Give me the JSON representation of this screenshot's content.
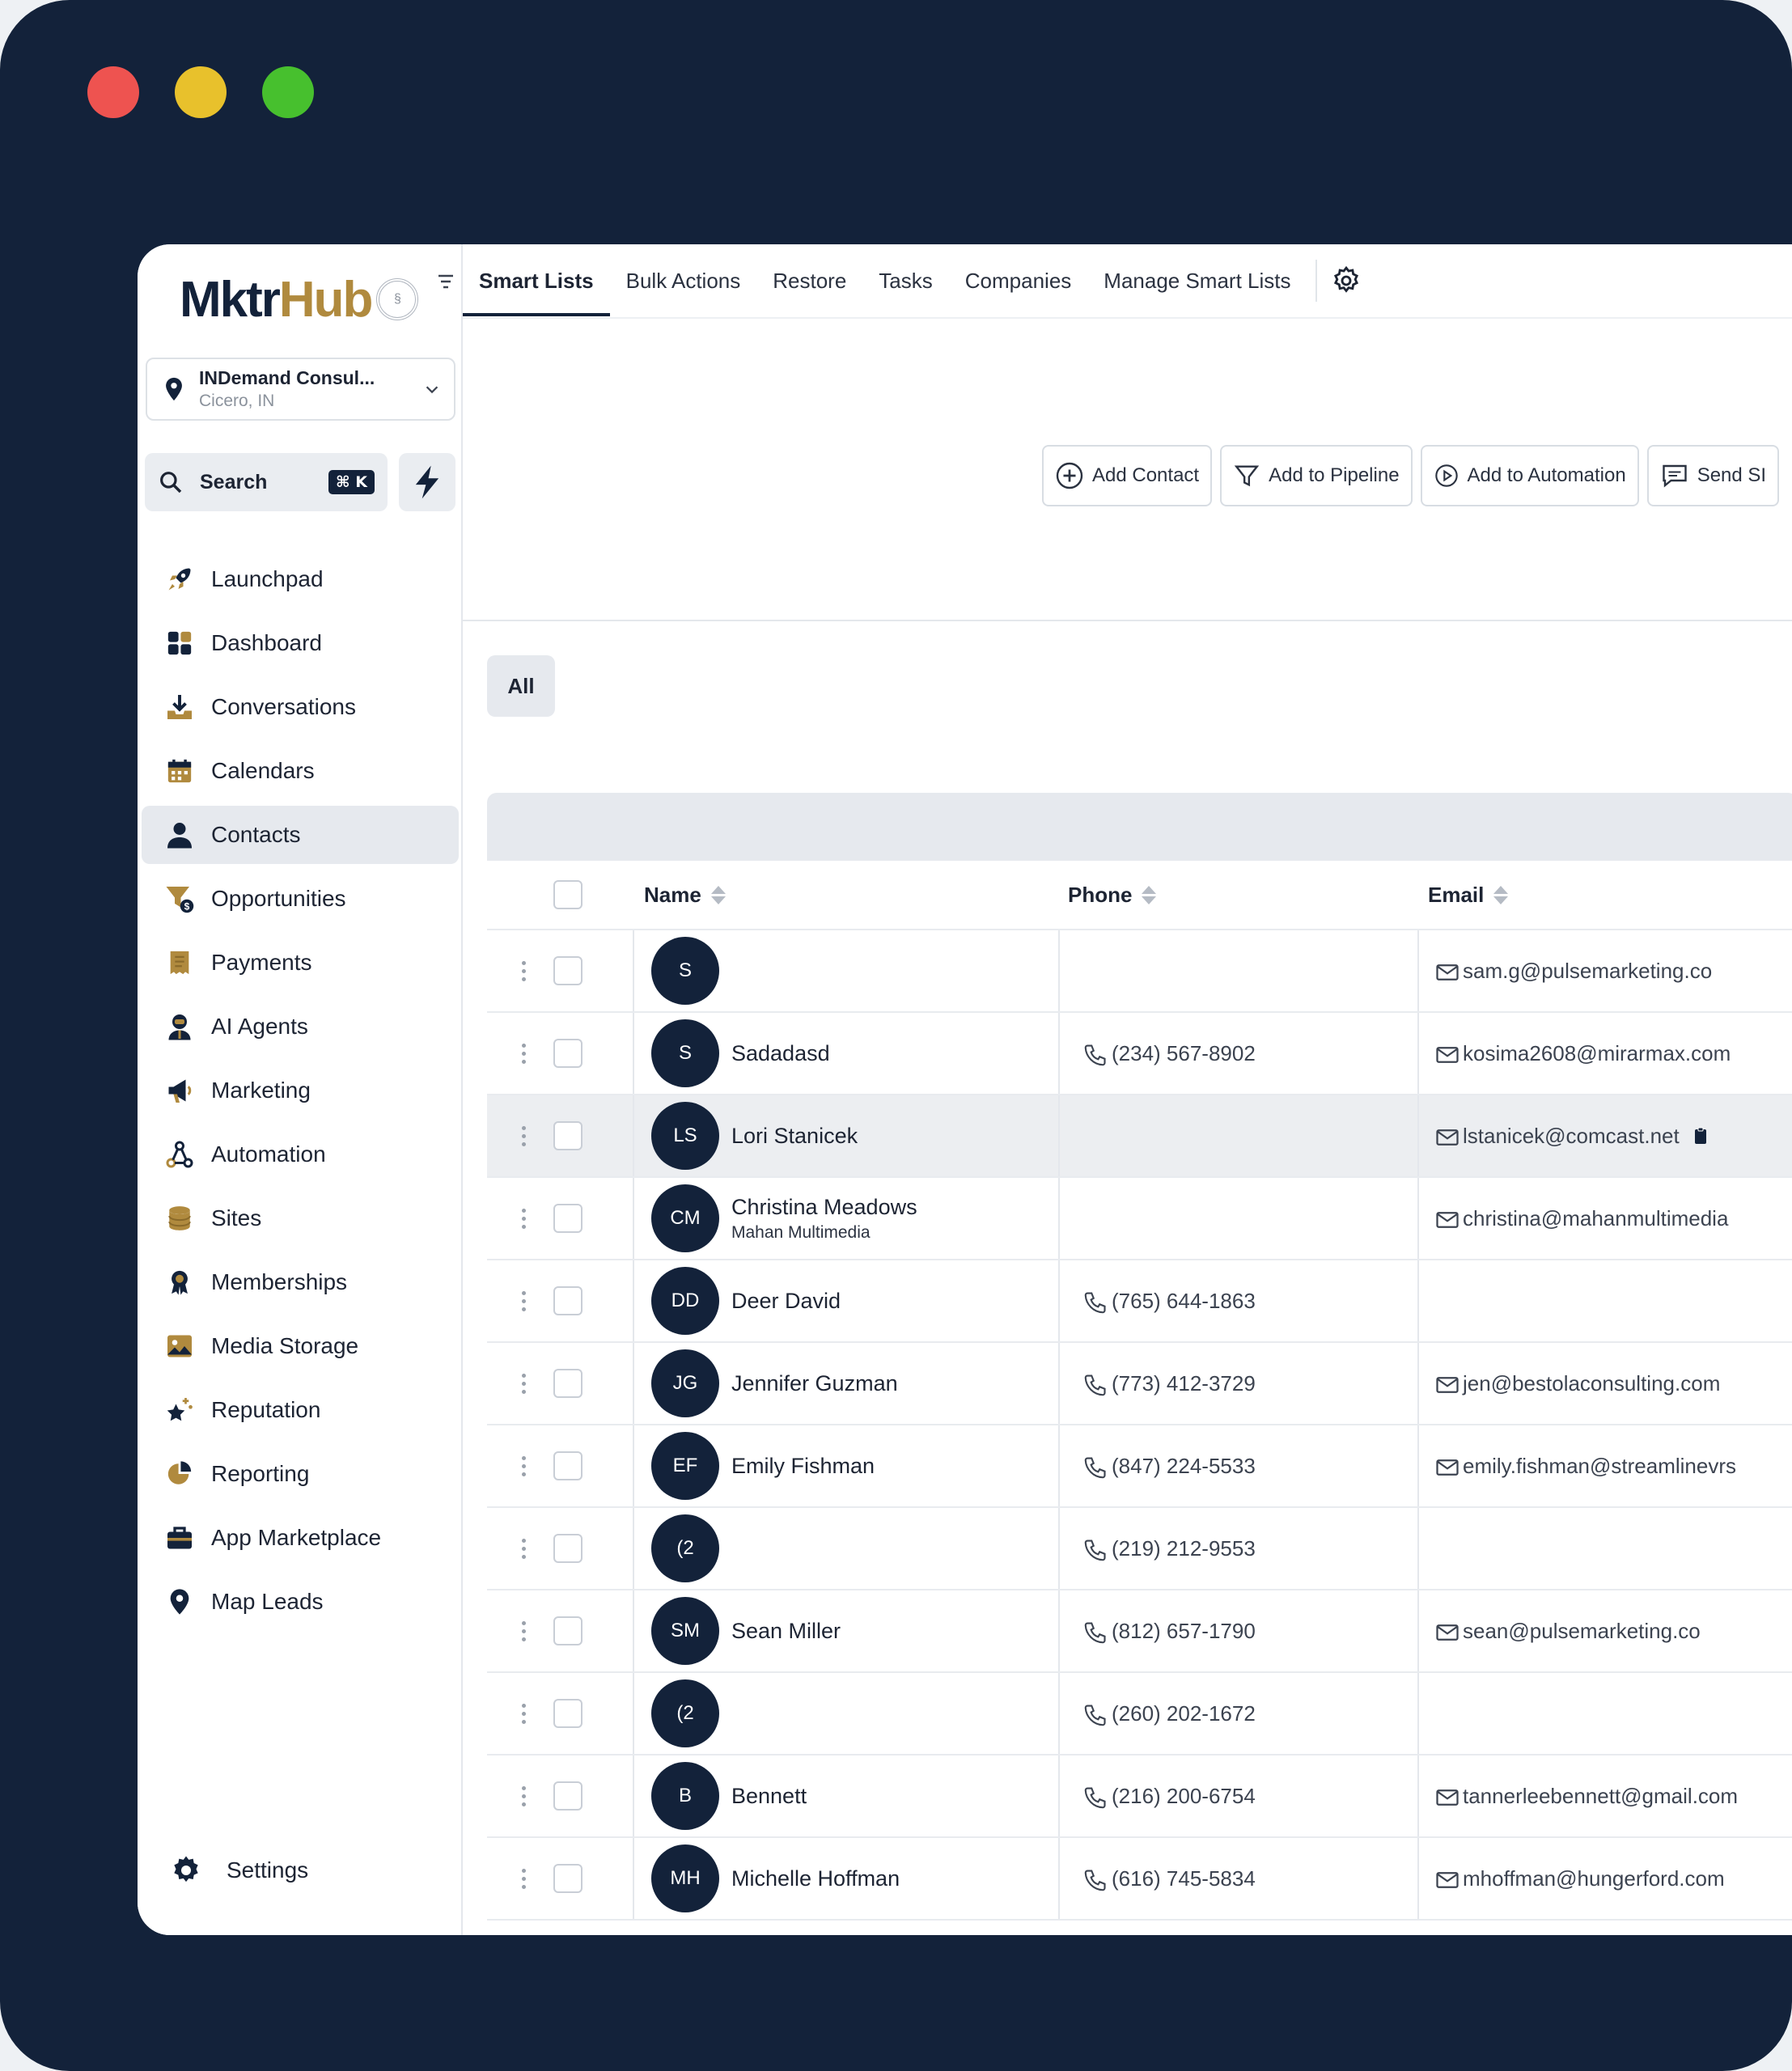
{
  "window_controls": {
    "close_color": "#ee5350",
    "minimize_color": "#e8c12c",
    "maximize_color": "#47c02e"
  },
  "brand": {
    "logo_part1": "Mktr",
    "logo_part2": "Hub",
    "seal_text": "§",
    "navy": "#13223a",
    "gold": "#b08a3e"
  },
  "account": {
    "name": "INDemand Consul...",
    "location": "Cicero, IN"
  },
  "search": {
    "label": "Search",
    "shortcut": "⌘ K"
  },
  "sidebar": {
    "items": [
      {
        "label": "Launchpad",
        "icon": "rocket-icon"
      },
      {
        "label": "Dashboard",
        "icon": "grid-icon"
      },
      {
        "label": "Conversations",
        "icon": "download-tray-icon"
      },
      {
        "label": "Calendars",
        "icon": "calendar-icon"
      },
      {
        "label": "Contacts",
        "icon": "person-icon",
        "active": true
      },
      {
        "label": "Opportunities",
        "icon": "funnel-dollar-icon"
      },
      {
        "label": "Payments",
        "icon": "receipt-icon"
      },
      {
        "label": "AI Agents",
        "icon": "agent-icon"
      },
      {
        "label": "Marketing",
        "icon": "megaphone-icon"
      },
      {
        "label": "Automation",
        "icon": "workflow-icon"
      },
      {
        "label": "Sites",
        "icon": "database-icon"
      },
      {
        "label": "Memberships",
        "icon": "award-icon"
      },
      {
        "label": "Media Storage",
        "icon": "image-icon"
      },
      {
        "label": "Reputation",
        "icon": "star-sparkle-icon"
      },
      {
        "label": "Reporting",
        "icon": "pie-chart-icon"
      },
      {
        "label": "App Marketplace",
        "icon": "briefcase-icon"
      },
      {
        "label": "Map Leads",
        "icon": "map-pin-icon"
      }
    ],
    "settings_label": "Settings"
  },
  "tabs": [
    "Smart Lists",
    "Bulk Actions",
    "Restore",
    "Tasks",
    "Companies",
    "Manage Smart Lists"
  ],
  "actions": {
    "add_contact": "Add Contact",
    "add_pipeline": "Add to Pipeline",
    "add_automation": "Add to Automation",
    "send": "Send SI"
  },
  "filter": {
    "all": "All"
  },
  "table": {
    "columns": {
      "name": "Name",
      "phone": "Phone",
      "email": "Email"
    },
    "rows": [
      {
        "initials": "S",
        "name": "",
        "company": "",
        "phone": "",
        "email": "sam.g@pulsemarketing.co"
      },
      {
        "initials": "S",
        "name": "Sadadasd",
        "company": "",
        "phone": "(234) 567-8902",
        "email": "kosima2608@mirarmax.com"
      },
      {
        "initials": "LS",
        "name": "Lori Stanicek",
        "company": "",
        "phone": "",
        "email": "lstanicek@comcast.net",
        "highlight": true
      },
      {
        "initials": "CM",
        "name": "Christina Meadows",
        "company": "Mahan Multimedia",
        "phone": "",
        "email": "christina@mahanmultimedia"
      },
      {
        "initials": "DD",
        "name": "Deer David",
        "company": "",
        "phone": "(765) 644-1863",
        "email": ""
      },
      {
        "initials": "JG",
        "name": "Jennifer Guzman",
        "company": "",
        "phone": "(773) 412-3729",
        "email": "jen@bestolaconsulting.com"
      },
      {
        "initials": "EF",
        "name": "Emily Fishman",
        "company": "",
        "phone": "(847) 224-5533",
        "email": "emily.fishman@streamlinevrs"
      },
      {
        "initials": "(2",
        "name": "",
        "company": "",
        "phone": "(219) 212-9553",
        "email": ""
      },
      {
        "initials": "SM",
        "name": "Sean Miller",
        "company": "",
        "phone": "(812) 657-1790",
        "email": "sean@pulsemarketing.co"
      },
      {
        "initials": "(2",
        "name": "",
        "company": "",
        "phone": "(260) 202-1672",
        "email": ""
      },
      {
        "initials": "B",
        "name": "Bennett",
        "company": "",
        "phone": "(216) 200-6754",
        "email": "tannerleebennett@gmail.com"
      },
      {
        "initials": "MH",
        "name": "Michelle Hoffman",
        "company": "",
        "phone": "(616) 745-5834",
        "email": "mhoffman@hungerford.com"
      }
    ]
  }
}
